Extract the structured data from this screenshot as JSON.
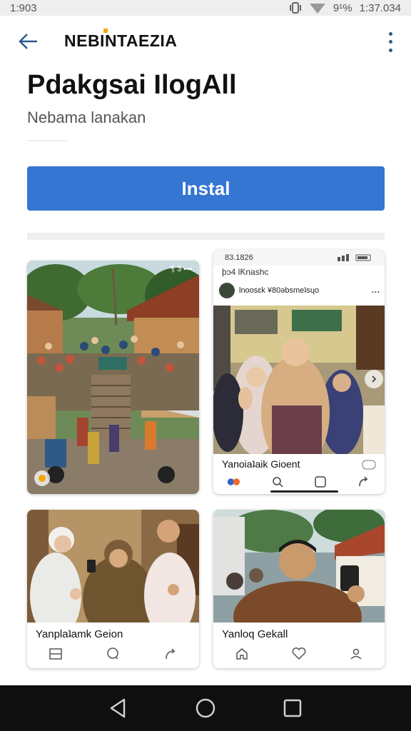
{
  "status_bar": {
    "time": "1:903",
    "battery_text": "9¹%",
    "clock_right": "1:37.034"
  },
  "app_bar": {
    "title": "NEBINTAEZIA",
    "back_icon": "arrow-left-icon",
    "more_icon": "more-vert-icon"
  },
  "app": {
    "name": "Pdakgsai IlogAll",
    "developer": "Nebama lanakan"
  },
  "install": {
    "label": "Instal",
    "color": "#3476d2"
  },
  "screenshots": [
    {
      "id": "village-stairs",
      "corner_label": "¶ 3 ▪▪▪"
    },
    {
      "id": "phone-post",
      "status_time": "83.1826",
      "app_label": "ϸᴐ4 lƘnashc",
      "post_author": "lnoosɛk ¥80ǝbsmeʇsɥo",
      "post_more": "...",
      "caption": "Yanoiaʇaik Gioent"
    },
    {
      "id": "selfie-group",
      "caption": "Yanplaʇamk Geion"
    },
    {
      "id": "man-selfie",
      "caption": "Yanloq Gekall"
    }
  ],
  "nav": {
    "back": "nav-back-icon",
    "home": "nav-home-icon",
    "recents": "nav-recents-icon"
  }
}
